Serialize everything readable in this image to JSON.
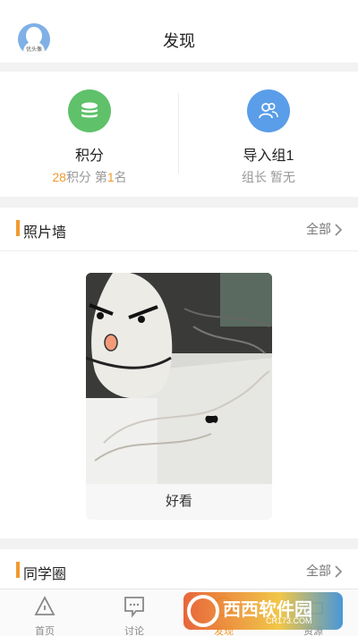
{
  "header": {
    "title": "发现",
    "avatar_text": "优头像"
  },
  "stats": [
    {
      "label": "积分",
      "sub_num": "28",
      "sub_text_1": "积分 第",
      "sub_num2": "1",
      "sub_text_2": "名",
      "icon": "coins-stack-icon",
      "color": "#5fc16a"
    },
    {
      "label": "导入组1",
      "sub": "组长 暂无",
      "icon": "group-icon",
      "color": "#5a9de8"
    }
  ],
  "photo_wall": {
    "title": "照片墙",
    "more": "全部",
    "caption": "好看"
  },
  "classmates": {
    "title": "同学圈",
    "more": "全部"
  },
  "tabbar": {
    "items": [
      {
        "label": "首页"
      },
      {
        "label": "讨论"
      },
      {
        "label": "发现"
      },
      {
        "label": "资源"
      }
    ],
    "active_color": "#f29a2e"
  },
  "watermark": {
    "text": "西西软件园",
    "url": "CR173.COM"
  }
}
